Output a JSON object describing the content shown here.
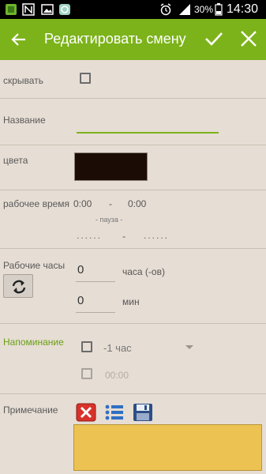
{
  "status_bar": {
    "battery_percent": "30%",
    "time": "14:30",
    "icons": [
      "app-notification-icon",
      "n-notification-icon",
      "image-notification-icon",
      "sync-notification-icon",
      "alarm-icon",
      "signal-icon",
      "battery-icon"
    ]
  },
  "app_bar": {
    "title": "Редактировать смену",
    "back_icon": "arrow-back-icon",
    "confirm_icon": "check-icon",
    "close_icon": "close-icon",
    "accent_color": "#7cb31a"
  },
  "form": {
    "hide_label": "скрывать",
    "hide_checked": false,
    "name_label": "Название",
    "name_value": "",
    "color_label": "цвета",
    "color_value": "#1c0c06",
    "work_time_label": "рабочее время",
    "start_time": "0:00",
    "time_separator": "-",
    "end_time": "0:00",
    "pause_label": "- пауза -",
    "pause_start": "......",
    "pause_separator": "-",
    "pause_end": "......",
    "work_hours_label": "Рабочие часы",
    "hours_value": "0",
    "hours_unit": "часа (-ов)",
    "minutes_value": "0",
    "minutes_unit": "мин",
    "refresh_icon": "refresh-icon",
    "reminder_label": "Напоминание",
    "reminder_option": "-1 час",
    "reminder_checked": false,
    "reminder_time": "00:00",
    "reminder_time_checked": false,
    "note_label": "Примечание",
    "note_value": "",
    "note_tools": [
      "delete-icon",
      "list-icon",
      "save-icon"
    ],
    "note_color": "#ecc252"
  }
}
